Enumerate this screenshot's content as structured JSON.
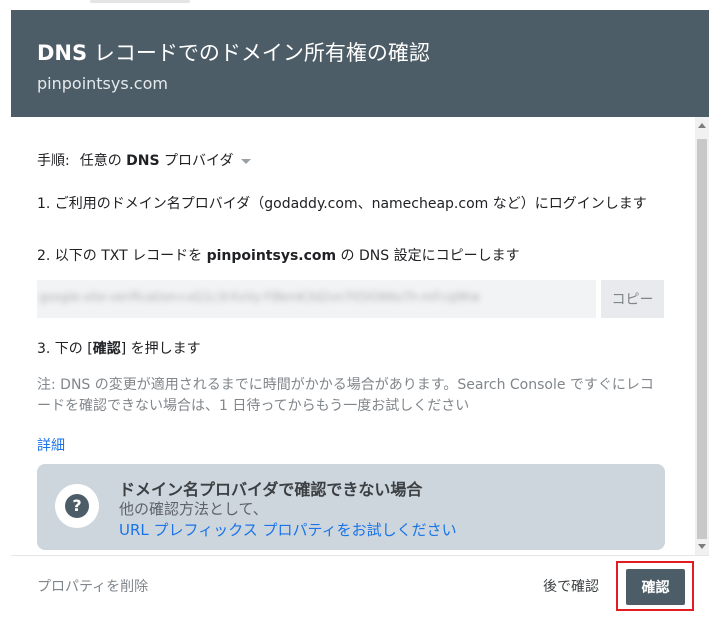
{
  "dialog": {
    "title_bold": "DNS",
    "title_rest": " レコードでのドメイン所有権の確認",
    "domain": "pinpointsys.com"
  },
  "method": {
    "label": "手順:",
    "value_pre": "任意の",
    "value_bold": "DNS",
    "value_post": " プロバイダ"
  },
  "steps": {
    "step1": "1. ご利用のドメイン名プロバイダ（godaddy.com、namecheap.com など）にログインします",
    "step2_pre": "2. 以下の TXT レコードを ",
    "step2_bold": "pinpointsys.com",
    "step2_post": " の DNS 設定にコピーします",
    "txt_record": "google-site-verification=xG1c3rXvVy-F8bmK3d2vn7lt5lO6Ko7h-mFcq9Kw",
    "copy_label": "コピー",
    "step3_pre": "3. 下の [",
    "step3_bold": "確認",
    "step3_post": "] を押します"
  },
  "note": "注: DNS の変更が適用されるまでに時間がかかる場合があります。Search Console ですぐにレコードを確認できない場合は、1 日待ってからもう一度お試しください",
  "detail_link": "詳細",
  "help_box": {
    "icon": "?",
    "heading": "ドメイン名プロバイダで確認できない場合",
    "line2": "他の確認方法として、",
    "link": "URL プレフィックス プロパティをお試しください"
  },
  "footer": {
    "delete_label": "プロパティを削除",
    "later_label": "後で確認",
    "verify_label": "確認"
  },
  "colors": {
    "header_bg": "#4d5d67",
    "link": "#1a73e8",
    "highlight": "#e31b23"
  }
}
